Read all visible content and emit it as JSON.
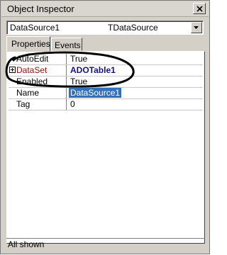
{
  "window": {
    "title": "Object Inspector"
  },
  "selector": {
    "object_name": "DataSource1",
    "object_type": "TDataSource"
  },
  "tabs": [
    {
      "label": "Properties",
      "active": true
    },
    {
      "label": "Events",
      "active": false
    }
  ],
  "properties": [
    {
      "name": "AutoEdit",
      "value": "True",
      "expandable": false,
      "selected": false
    },
    {
      "name": "DataSet",
      "value": "ADOTable1",
      "expandable": true,
      "selected": false
    },
    {
      "name": "Enabled",
      "value": "True",
      "expandable": false,
      "selected": false
    },
    {
      "name": "Name",
      "value": "DataSource1",
      "expandable": false,
      "selected": true
    },
    {
      "name": "Tag",
      "value": "0",
      "expandable": false,
      "selected": false
    }
  ],
  "status": {
    "text": "All shown"
  },
  "colors": {
    "selection": "#3470b8",
    "dataset_name": "#8c1010",
    "dataset_value": "#14147a"
  },
  "icons": {
    "close": "close-icon",
    "dropdown": "dropdown-arrow-icon",
    "expand": "expand-plus-icon"
  }
}
